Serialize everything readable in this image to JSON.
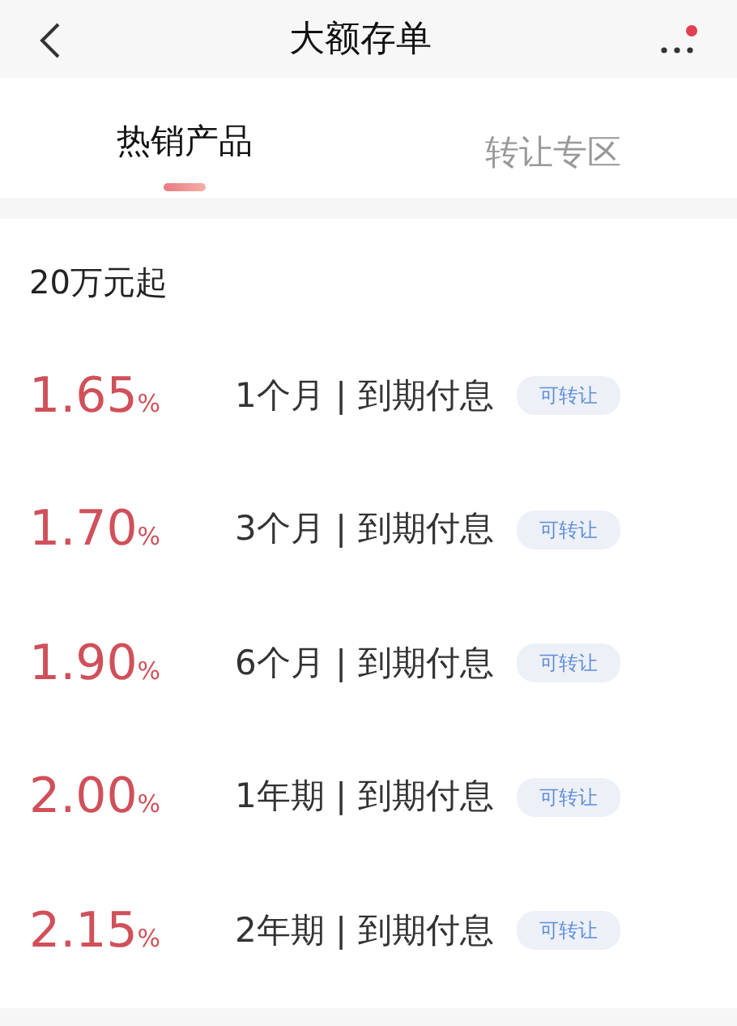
{
  "header": {
    "title": "大额存单",
    "has_notification": true
  },
  "tabs": [
    {
      "label": "热销产品",
      "selected": true
    },
    {
      "label": "转让专区",
      "selected": false
    }
  ],
  "section": {
    "heading": "20万元起"
  },
  "products": [
    {
      "rate": "1.65",
      "unit": "%",
      "term": "1个月 | 到期付息",
      "tag": "可转让"
    },
    {
      "rate": "1.70",
      "unit": "%",
      "term": "3个月 | 到期付息",
      "tag": "可转让"
    },
    {
      "rate": "1.90",
      "unit": "%",
      "term": "6个月 | 到期付息",
      "tag": "可转让"
    },
    {
      "rate": "2.00",
      "unit": "%",
      "term": "1年期 | 到期付息",
      "tag": "可转让"
    },
    {
      "rate": "2.15",
      "unit": "%",
      "term": "2年期 | 到期付息",
      "tag": "可转让"
    }
  ]
}
